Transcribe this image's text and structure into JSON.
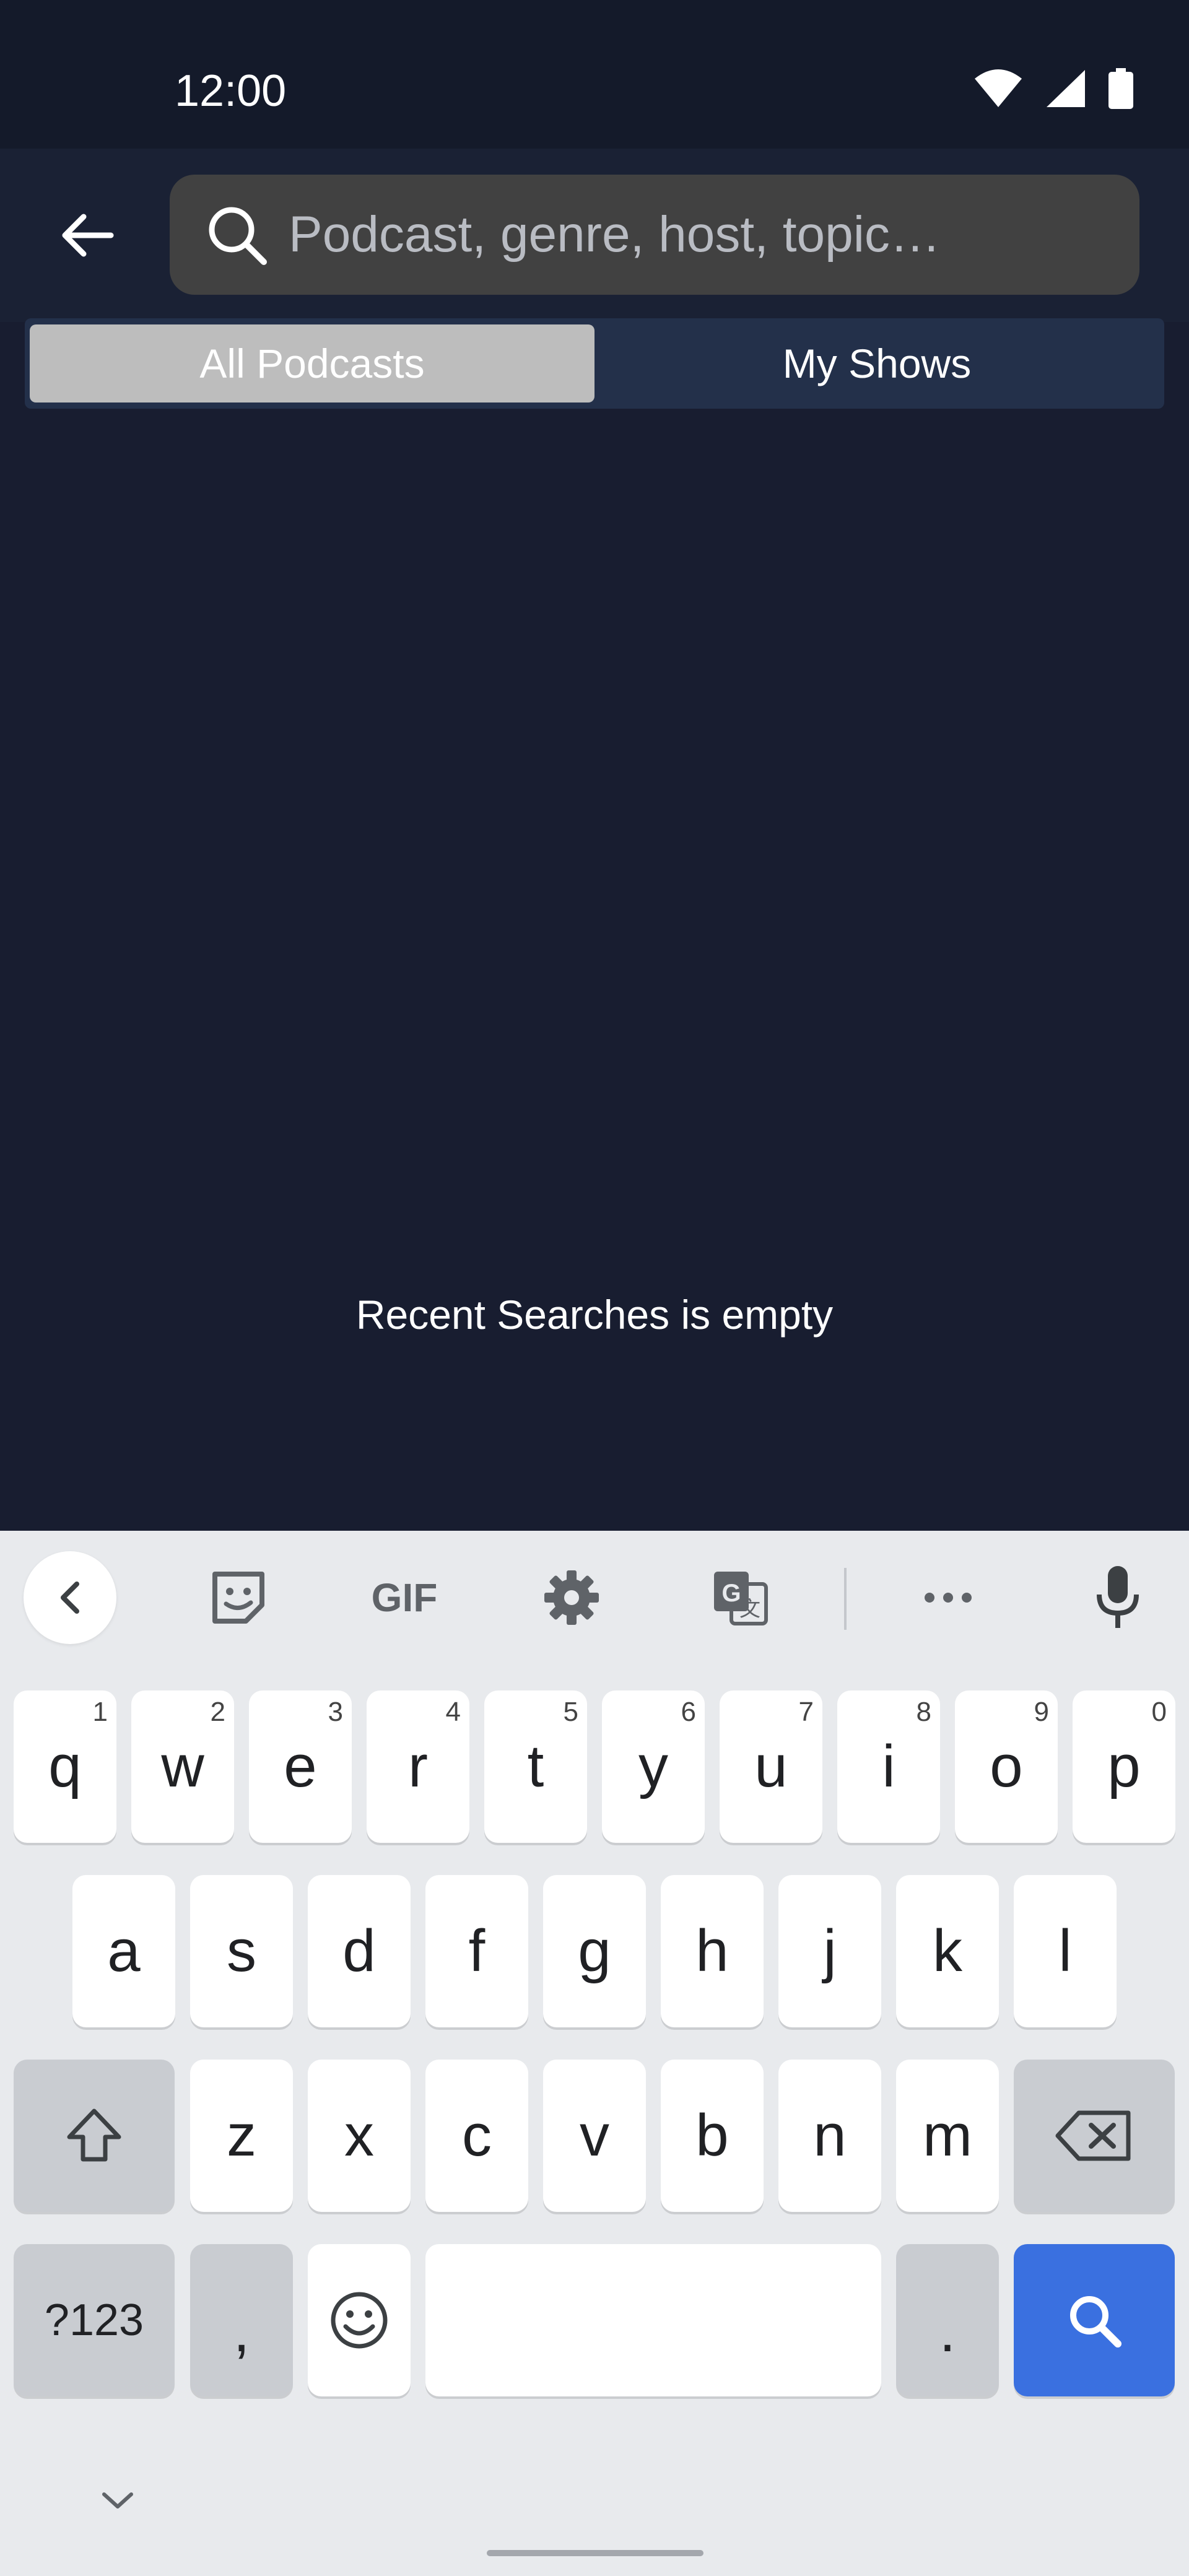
{
  "status": {
    "time": "12:00"
  },
  "search": {
    "placeholder": "Podcast, genre, host, topic…",
    "value": ""
  },
  "tabs": [
    {
      "label": "All Podcasts",
      "selected": true
    },
    {
      "label": "My Shows",
      "selected": false
    }
  ],
  "empty_state": {
    "text": "Recent Searches is empty"
  },
  "keyboard": {
    "toolbar": [
      "collapse-icon",
      "sticker-icon",
      "GIF",
      "settings-icon",
      "translate-icon",
      "more-icon",
      "microphone-icon"
    ],
    "gif_label": "GIF",
    "row1": [
      {
        "key": "q",
        "hint": "1"
      },
      {
        "key": "w",
        "hint": "2"
      },
      {
        "key": "e",
        "hint": "3"
      },
      {
        "key": "r",
        "hint": "4"
      },
      {
        "key": "t",
        "hint": "5"
      },
      {
        "key": "y",
        "hint": "6"
      },
      {
        "key": "u",
        "hint": "7"
      },
      {
        "key": "i",
        "hint": "8"
      },
      {
        "key": "o",
        "hint": "9"
      },
      {
        "key": "p",
        "hint": "0"
      }
    ],
    "row2": [
      "a",
      "s",
      "d",
      "f",
      "g",
      "h",
      "j",
      "k",
      "l"
    ],
    "row3": [
      "z",
      "x",
      "c",
      "v",
      "b",
      "n",
      "m"
    ],
    "symbols_label": "?123",
    "comma_label": ",",
    "period_label": ".",
    "colors": {
      "background": "#e8eaed",
      "key": "#ffffff",
      "function_key": "#c9ccd1",
      "action_key": "#3a70e0"
    }
  },
  "colors": {
    "app_background": "#181d30",
    "status_bar": "#141a2a",
    "app_bar": "#1a2134",
    "search_field": "#414141",
    "tab_selected": "#bdbdbd",
    "tab_track": "#23304a"
  }
}
